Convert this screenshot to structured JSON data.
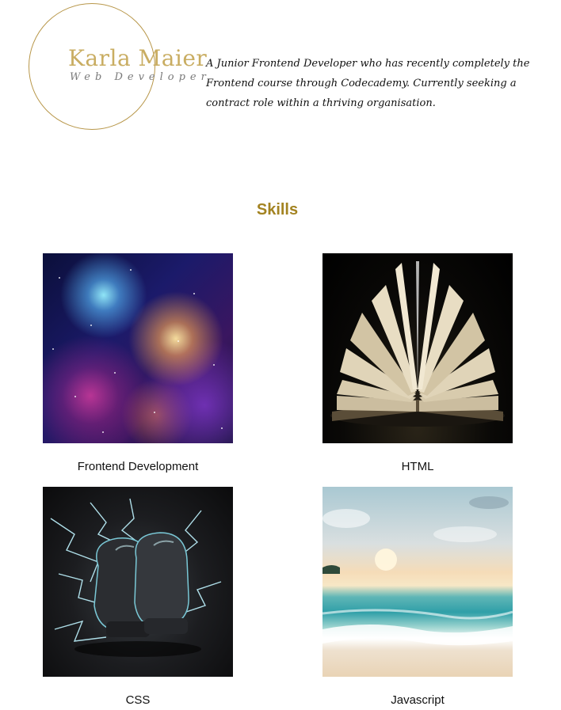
{
  "header": {
    "logo_name": "Karla Maier",
    "logo_role": "Web Developer",
    "intro": "A Junior Frontend Developer who has recently completely the Frontend course through Codecademy. Currently seeking a contract role within a thriving organisation."
  },
  "skills": {
    "title": "Skills",
    "items": [
      {
        "label": "Frontend Development",
        "image": "galaxy-image"
      },
      {
        "label": "HTML",
        "image": "open-book-image"
      },
      {
        "label": "CSS",
        "image": "boxing-gloves-image"
      },
      {
        "label": "Javascript",
        "image": "beach-image"
      }
    ]
  },
  "colors": {
    "accent": "#a38321",
    "logo_ring": "#b8974a"
  }
}
